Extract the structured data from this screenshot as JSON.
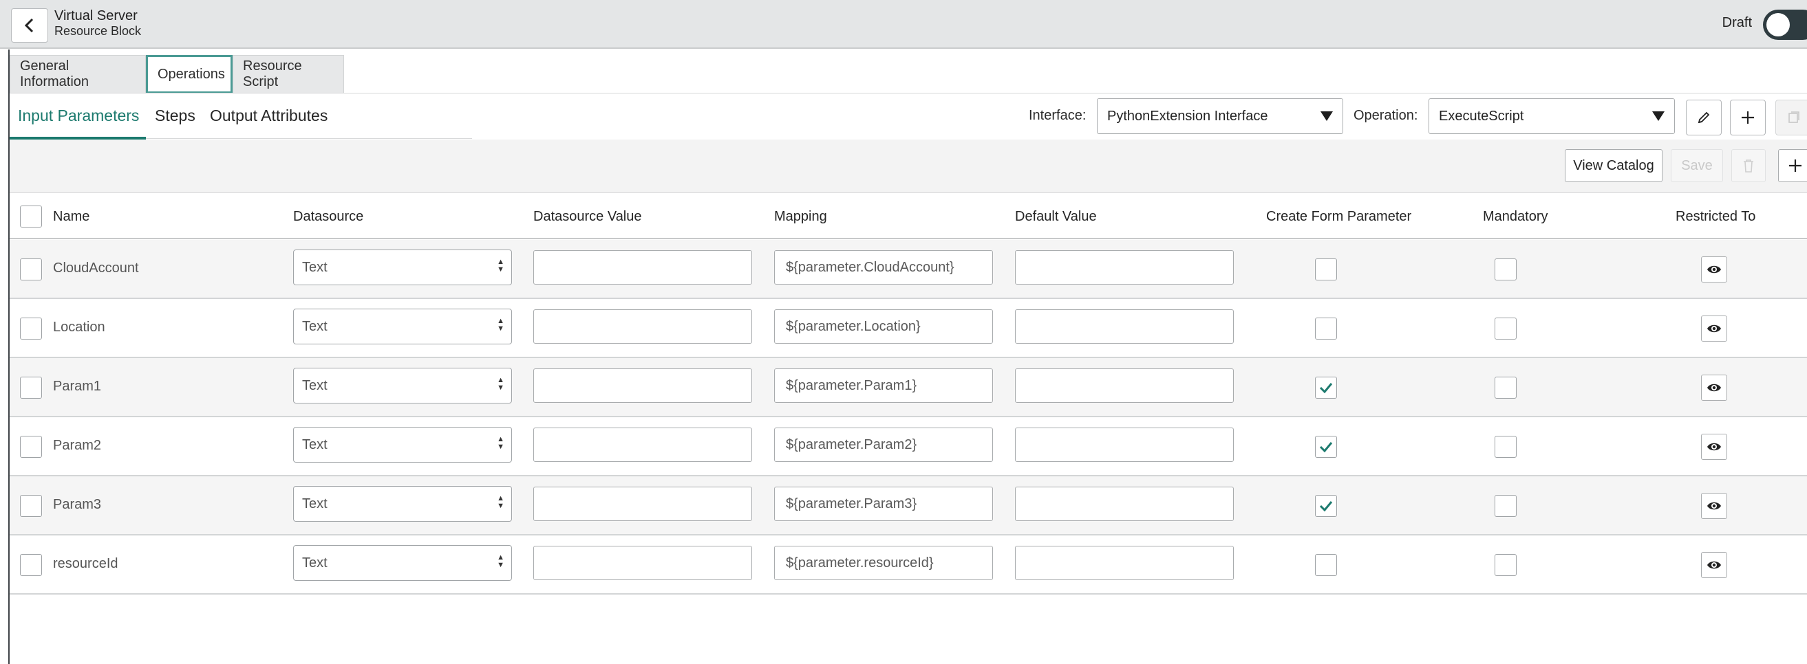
{
  "header": {
    "title": "Virtual Server",
    "subtitle": "Resource Block",
    "draft_label": "Draft",
    "back_icon": "chevron-left-icon"
  },
  "top_tabs": [
    {
      "label": "General Information",
      "active": false
    },
    {
      "label": "Operations",
      "active": true
    },
    {
      "label": "Resource Script",
      "active": false
    }
  ],
  "sub_tabs": [
    {
      "label": "Input Parameters",
      "active": true
    },
    {
      "label": "Steps",
      "active": false
    },
    {
      "label": "Output Attributes",
      "active": false
    }
  ],
  "interface": {
    "label": "Interface:",
    "value": "PythonExtension Interface"
  },
  "operation": {
    "label": "Operation:",
    "value": "ExecuteScript"
  },
  "toolbar": {
    "view_catalog": "View Catalog",
    "save": "Save"
  },
  "table": {
    "columns": [
      "Name",
      "Datasource",
      "Datasource Value",
      "Mapping",
      "Default Value",
      "Create Form Parameter",
      "Mandatory",
      "Restricted To"
    ],
    "rows": [
      {
        "name": "CloudAccount",
        "datasource": "Text",
        "datasource_value": "",
        "mapping": "${parameter.CloudAccount}",
        "default_value": "",
        "create_form_parameter": false,
        "mandatory": false
      },
      {
        "name": "Location",
        "datasource": "Text",
        "datasource_value": "",
        "mapping": "${parameter.Location}",
        "default_value": "",
        "create_form_parameter": false,
        "mandatory": false
      },
      {
        "name": "Param1",
        "datasource": "Text",
        "datasource_value": "",
        "mapping": "${parameter.Param1}",
        "default_value": "",
        "create_form_parameter": true,
        "mandatory": false
      },
      {
        "name": "Param2",
        "datasource": "Text",
        "datasource_value": "",
        "mapping": "${parameter.Param2}",
        "default_value": "",
        "create_form_parameter": true,
        "mandatory": false
      },
      {
        "name": "Param3",
        "datasource": "Text",
        "datasource_value": "",
        "mapping": "${parameter.Param3}",
        "default_value": "",
        "create_form_parameter": true,
        "mandatory": false
      },
      {
        "name": "resourceId",
        "datasource": "Text",
        "datasource_value": "",
        "mapping": "${parameter.resourceId}",
        "default_value": "",
        "create_form_parameter": false,
        "mandatory": false
      }
    ]
  },
  "colors": {
    "accent": "#1c7a6e",
    "check": "#1c7a6e"
  }
}
